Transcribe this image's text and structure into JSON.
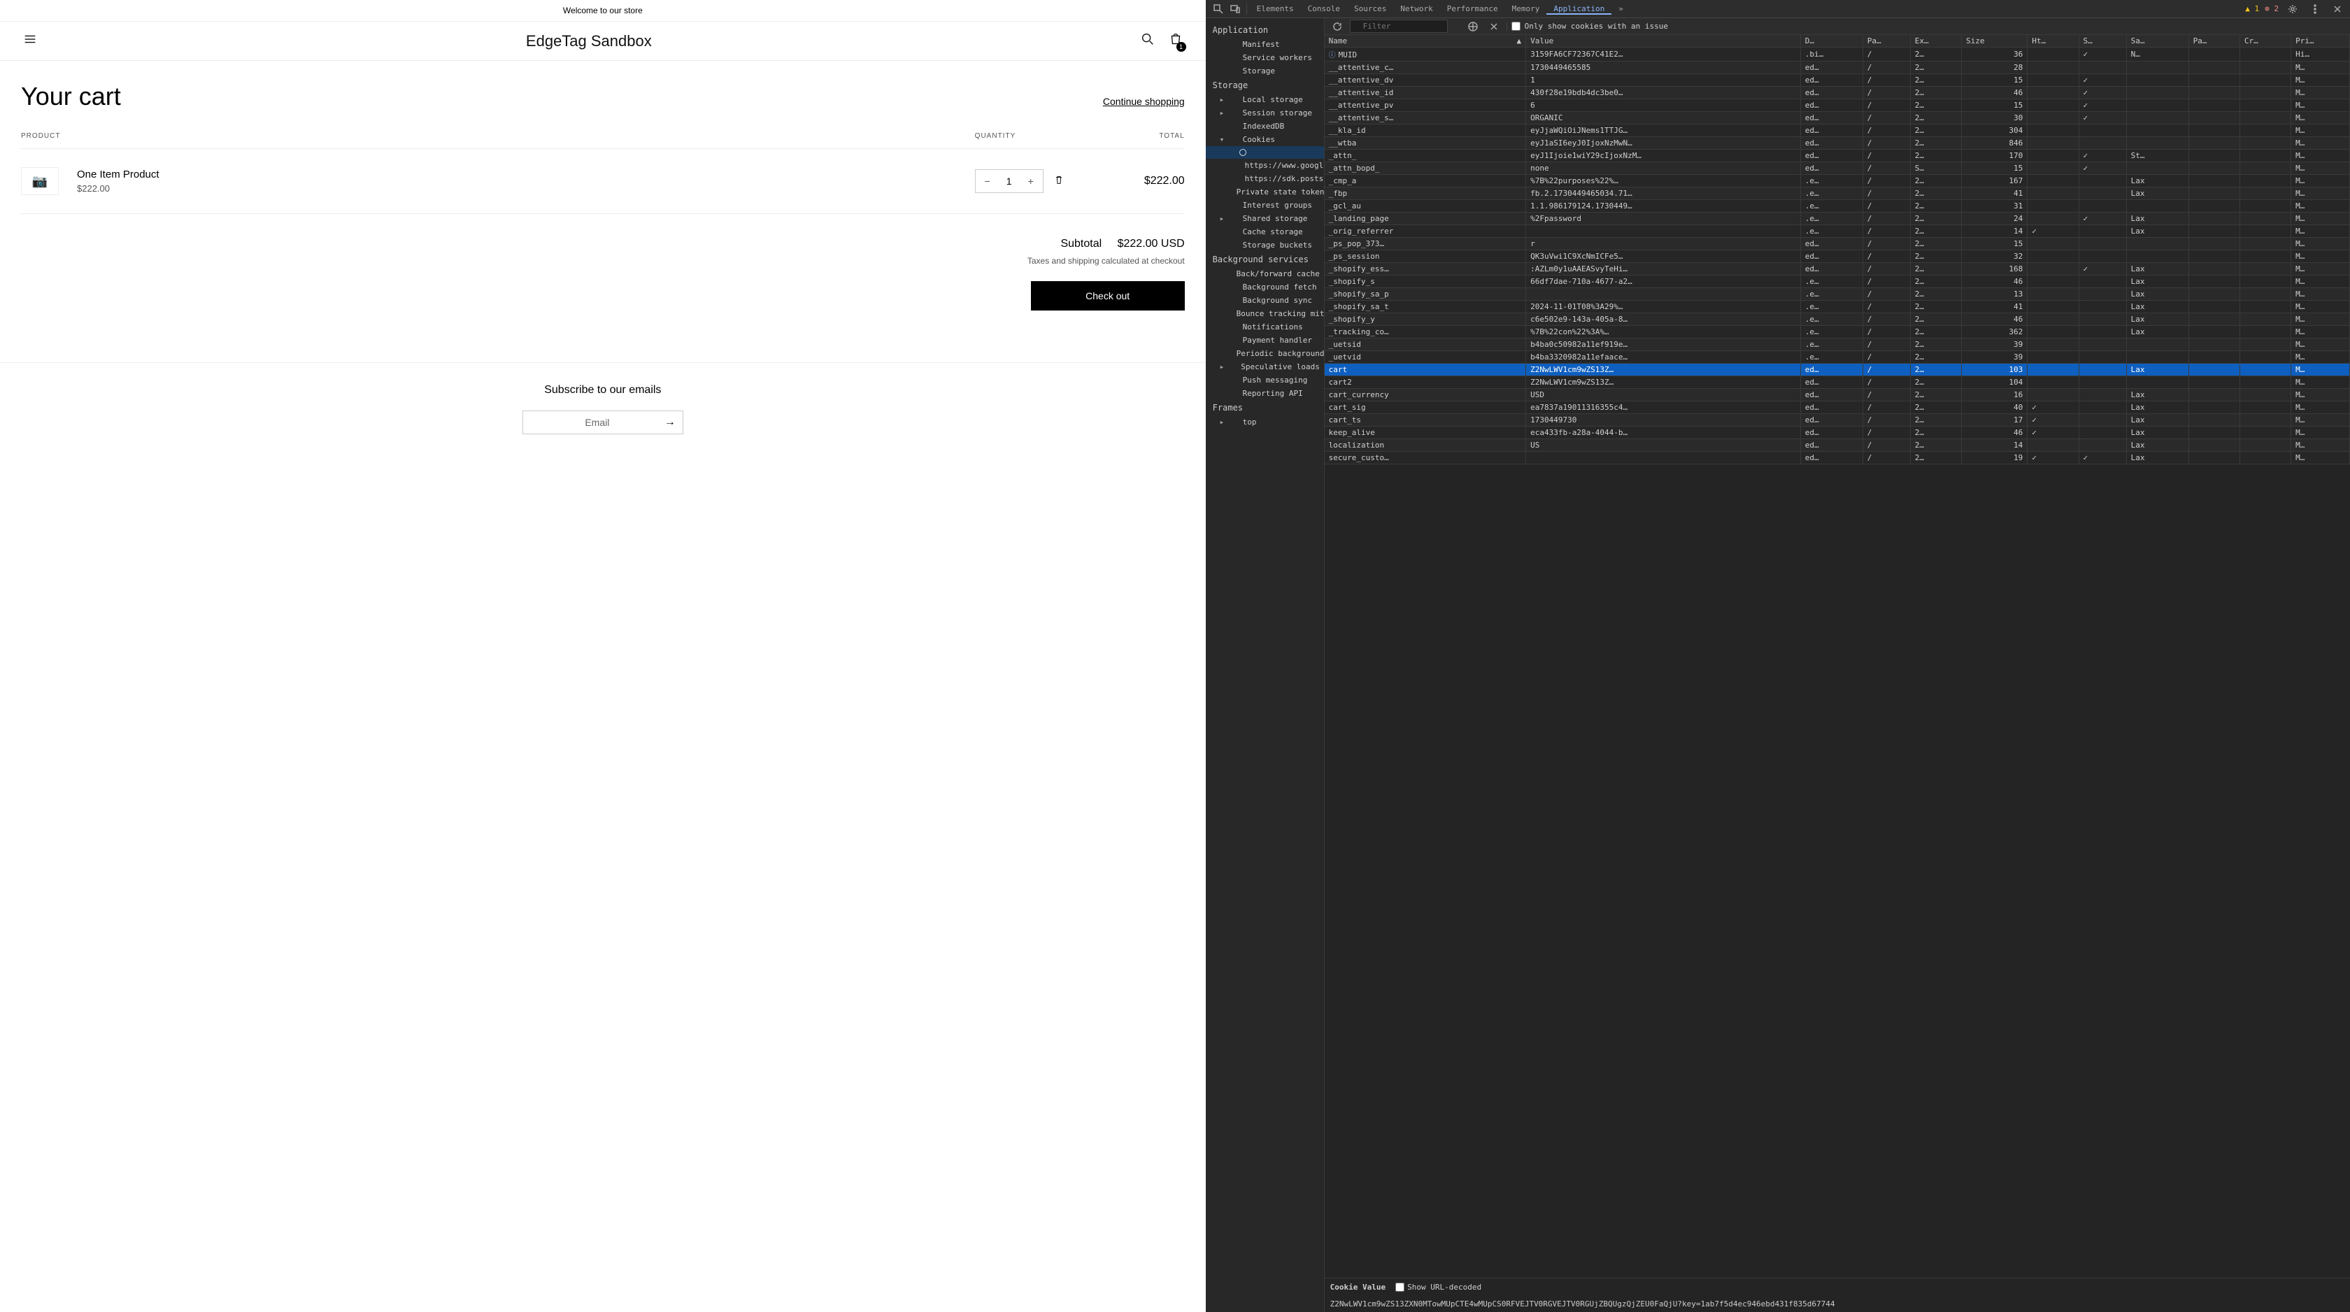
{
  "store": {
    "welcome": "Welcome to our store",
    "brand": "EdgeTag Sandbox",
    "cart_badge": "1",
    "cart_title": "Your cart",
    "continue": "Continue shopping",
    "headers": {
      "product": "PRODUCT",
      "quantity": "QUANTITY",
      "total": "TOTAL"
    },
    "item": {
      "name": "One Item Product",
      "price": "$222.00",
      "qty": "1",
      "total": "$222.00"
    },
    "subtotal_label": "Subtotal",
    "subtotal_value": "$222.00 USD",
    "tax_note": "Taxes and shipping calculated at checkout",
    "checkout": "Check out",
    "subscribe_title": "Subscribe to our emails",
    "email_label": "Email"
  },
  "devtools": {
    "tabs": [
      "Elements",
      "Console",
      "Sources",
      "Network",
      "Performance",
      "Memory",
      "Application"
    ],
    "active_tab": "Application",
    "warn_count": "1",
    "err_count": "2",
    "filter_placeholder": "Filter",
    "only_issue_label": "Only show cookies with an issue",
    "sidebar": {
      "sections": [
        {
          "title": "Application",
          "items": [
            "Manifest",
            "Service workers",
            "Storage"
          ]
        },
        {
          "title": "Storage",
          "items": []
        },
        {
          "title": "Background services",
          "items": []
        },
        {
          "title": "Frames",
          "items": []
        }
      ],
      "storage_items": [
        "Local storage",
        "Session storage",
        "IndexedDB",
        "Cookies"
      ],
      "cookie_children": [
        "https://www.googlet…",
        "https://sdk.postscri…"
      ],
      "storage_items2": [
        "Private state tokens",
        "Interest groups",
        "Shared storage",
        "Cache storage",
        "Storage buckets"
      ],
      "bg_items": [
        "Back/forward cache",
        "Background fetch",
        "Background sync",
        "Bounce tracking mitiga…",
        "Notifications",
        "Payment handler",
        "Periodic background s…",
        "Speculative loads",
        "Push messaging",
        "Reporting API"
      ],
      "frames_items": [
        "top"
      ]
    },
    "columns": [
      "Name",
      "Value",
      "D…",
      "Pa…",
      "Ex…",
      "Size",
      "Ht…",
      "S…",
      "Sa…",
      "Pa…",
      "Cr…",
      "Pri…"
    ],
    "rows": [
      {
        "n": "MUID",
        "v": "3159FA6CF72367C41E2…",
        "d": ".bi…",
        "p": "/",
        "e": "2…",
        "s": "36",
        "h": "",
        "sec": "✓",
        "sa": "N…",
        "pa": "",
        "cr": "",
        "pr": "Hi…",
        "info": true
      },
      {
        "n": "__attentive_c…",
        "v": "1730449465585",
        "d": "ed…",
        "p": "/",
        "e": "2…",
        "s": "28",
        "h": "",
        "sec": "",
        "sa": "",
        "pa": "",
        "cr": "",
        "pr": "M…"
      },
      {
        "n": "__attentive_dv",
        "v": "1",
        "d": "ed…",
        "p": "/",
        "e": "2…",
        "s": "15",
        "h": "",
        "sec": "✓",
        "sa": "",
        "pa": "",
        "cr": "",
        "pr": "M…"
      },
      {
        "n": "__attentive_id",
        "v": "430f28e19bdb4dc3be0…",
        "d": "ed…",
        "p": "/",
        "e": "2…",
        "s": "46",
        "h": "",
        "sec": "✓",
        "sa": "",
        "pa": "",
        "cr": "",
        "pr": "M…"
      },
      {
        "n": "__attentive_pv",
        "v": "6",
        "d": "ed…",
        "p": "/",
        "e": "2…",
        "s": "15",
        "h": "",
        "sec": "✓",
        "sa": "",
        "pa": "",
        "cr": "",
        "pr": "M…"
      },
      {
        "n": "__attentive_s…",
        "v": "ORGANIC",
        "d": "ed…",
        "p": "/",
        "e": "2…",
        "s": "30",
        "h": "",
        "sec": "✓",
        "sa": "",
        "pa": "",
        "cr": "",
        "pr": "M…"
      },
      {
        "n": "__kla_id",
        "v": "eyJjaWQiOiJNems1TTJG…",
        "d": "ed…",
        "p": "/",
        "e": "2…",
        "s": "304",
        "h": "",
        "sec": "",
        "sa": "",
        "pa": "",
        "cr": "",
        "pr": "M…"
      },
      {
        "n": "__wtba",
        "v": "eyJ1aSI6eyJ0IjoxNzMwN…",
        "d": "ed…",
        "p": "/",
        "e": "2…",
        "s": "846",
        "h": "",
        "sec": "",
        "sa": "",
        "pa": "",
        "cr": "",
        "pr": "M…"
      },
      {
        "n": "_attn_",
        "v": "eyJ1Ijoie1wiY29cIjoxNzM…",
        "d": "ed…",
        "p": "/",
        "e": "2…",
        "s": "170",
        "h": "",
        "sec": "✓",
        "sa": "St…",
        "pa": "",
        "cr": "",
        "pr": "M…"
      },
      {
        "n": "_attn_bopd_",
        "v": "none",
        "d": "ed…",
        "p": "/",
        "e": "S…",
        "s": "15",
        "h": "",
        "sec": "✓",
        "sa": "",
        "pa": "",
        "cr": "",
        "pr": "M…"
      },
      {
        "n": "_cmp_a",
        "v": "%7B%22purposes%22%…",
        "d": ".e…",
        "p": "/",
        "e": "2…",
        "s": "167",
        "h": "",
        "sec": "",
        "sa": "Lax",
        "pa": "",
        "cr": "",
        "pr": "M…"
      },
      {
        "n": "_fbp",
        "v": "fb.2.1730449465034.71…",
        "d": ".e…",
        "p": "/",
        "e": "2…",
        "s": "41",
        "h": "",
        "sec": "",
        "sa": "Lax",
        "pa": "",
        "cr": "",
        "pr": "M…"
      },
      {
        "n": "_gcl_au",
        "v": "1.1.986179124.1730449…",
        "d": ".e…",
        "p": "/",
        "e": "2…",
        "s": "31",
        "h": "",
        "sec": "",
        "sa": "",
        "pa": "",
        "cr": "",
        "pr": "M…"
      },
      {
        "n": "_landing_page",
        "v": "%2Fpassword",
        "d": ".e…",
        "p": "/",
        "e": "2…",
        "s": "24",
        "h": "",
        "sec": "✓",
        "sa": "Lax",
        "pa": "",
        "cr": "",
        "pr": "M…"
      },
      {
        "n": "_orig_referrer",
        "v": "",
        "d": ".e…",
        "p": "/",
        "e": "2…",
        "s": "14",
        "h": "✓",
        "sec": "",
        "sa": "Lax",
        "pa": "",
        "cr": "",
        "pr": "M…"
      },
      {
        "n": "_ps_pop_373…",
        "v": "r",
        "d": "ed…",
        "p": "/",
        "e": "2…",
        "s": "15",
        "h": "",
        "sec": "",
        "sa": "",
        "pa": "",
        "cr": "",
        "pr": "M…"
      },
      {
        "n": "_ps_session",
        "v": "QK3uVwi1C9XcNmICFe5…",
        "d": "ed…",
        "p": "/",
        "e": "2…",
        "s": "32",
        "h": "",
        "sec": "",
        "sa": "",
        "pa": "",
        "cr": "",
        "pr": "M…"
      },
      {
        "n": "_shopify_ess…",
        "v": ":AZLm0y1uAAEASvyTeHi…",
        "d": "ed…",
        "p": "/",
        "e": "2…",
        "s": "168",
        "h": "",
        "sec": "✓",
        "sa": "Lax",
        "pa": "",
        "cr": "",
        "pr": "M…"
      },
      {
        "n": "_shopify_s",
        "v": "66df7dae-710a-4677-a2…",
        "d": ".e…",
        "p": "/",
        "e": "2…",
        "s": "46",
        "h": "",
        "sec": "",
        "sa": "Lax",
        "pa": "",
        "cr": "",
        "pr": "M…"
      },
      {
        "n": "_shopify_sa_p",
        "v": "",
        "d": ".e…",
        "p": "/",
        "e": "2…",
        "s": "13",
        "h": "",
        "sec": "",
        "sa": "Lax",
        "pa": "",
        "cr": "",
        "pr": "M…"
      },
      {
        "n": "_shopify_sa_t",
        "v": "2024-11-01T08%3A29%…",
        "d": ".e…",
        "p": "/",
        "e": "2…",
        "s": "41",
        "h": "",
        "sec": "",
        "sa": "Lax",
        "pa": "",
        "cr": "",
        "pr": "M…"
      },
      {
        "n": "_shopify_y",
        "v": "c6e502e9-143a-405a-8…",
        "d": ".e…",
        "p": "/",
        "e": "2…",
        "s": "46",
        "h": "",
        "sec": "",
        "sa": "Lax",
        "pa": "",
        "cr": "",
        "pr": "M…"
      },
      {
        "n": "_tracking_co…",
        "v": "%7B%22con%22%3A%…",
        "d": ".e…",
        "p": "/",
        "e": "2…",
        "s": "362",
        "h": "",
        "sec": "",
        "sa": "Lax",
        "pa": "",
        "cr": "",
        "pr": "M…"
      },
      {
        "n": "_uetsid",
        "v": "b4ba0c50982a11ef919e…",
        "d": ".e…",
        "p": "/",
        "e": "2…",
        "s": "39",
        "h": "",
        "sec": "",
        "sa": "",
        "pa": "",
        "cr": "",
        "pr": "M…"
      },
      {
        "n": "_uetvid",
        "v": "b4ba3320982a11efaace…",
        "d": ".e…",
        "p": "/",
        "e": "2…",
        "s": "39",
        "h": "",
        "sec": "",
        "sa": "",
        "pa": "",
        "cr": "",
        "pr": "M…"
      },
      {
        "n": "cart",
        "v": "Z2NwLWV1cm9wZS13Z…",
        "d": "ed…",
        "p": "/",
        "e": "2…",
        "s": "103",
        "h": "",
        "sec": "",
        "sa": "Lax",
        "pa": "",
        "cr": "",
        "pr": "M…",
        "sel": true
      },
      {
        "n": "cart2",
        "v": "Z2NwLWV1cm9wZS13Z…",
        "d": "ed…",
        "p": "/",
        "e": "2…",
        "s": "104",
        "h": "",
        "sec": "",
        "sa": "",
        "pa": "",
        "cr": "",
        "pr": "M…"
      },
      {
        "n": "cart_currency",
        "v": "USD",
        "d": "ed…",
        "p": "/",
        "e": "2…",
        "s": "16",
        "h": "",
        "sec": "",
        "sa": "Lax",
        "pa": "",
        "cr": "",
        "pr": "M…"
      },
      {
        "n": "cart_sig",
        "v": "ea7837a19011316355c4…",
        "d": "ed…",
        "p": "/",
        "e": "2…",
        "s": "40",
        "h": "✓",
        "sec": "",
        "sa": "Lax",
        "pa": "",
        "cr": "",
        "pr": "M…"
      },
      {
        "n": "cart_ts",
        "v": "1730449730",
        "d": "ed…",
        "p": "/",
        "e": "2…",
        "s": "17",
        "h": "✓",
        "sec": "",
        "sa": "Lax",
        "pa": "",
        "cr": "",
        "pr": "M…"
      },
      {
        "n": "keep_alive",
        "v": "eca433fb-a28a-4044-b…",
        "d": "ed…",
        "p": "/",
        "e": "2…",
        "s": "46",
        "h": "✓",
        "sec": "",
        "sa": "Lax",
        "pa": "",
        "cr": "",
        "pr": "M…"
      },
      {
        "n": "localization",
        "v": "US",
        "d": "ed…",
        "p": "/",
        "e": "2…",
        "s": "14",
        "h": "",
        "sec": "",
        "sa": "Lax",
        "pa": "",
        "cr": "",
        "pr": "M…"
      },
      {
        "n": "secure_custo…",
        "v": "",
        "d": "ed…",
        "p": "/",
        "e": "2…",
        "s": "19",
        "h": "✓",
        "sec": "✓",
        "sa": "Lax",
        "pa": "",
        "cr": "",
        "pr": "M…"
      }
    ],
    "cookie_value_label": "Cookie Value",
    "show_decoded_label": "Show URL-decoded",
    "cookie_value": "Z2NwLWV1cm9wZS13ZXN0MTowMUpCTE4wMUpCS0RFVEJTV0RGVEJTV0RGUjZBQUgzQjZEU0FaQjU?key=1ab7f5d4ec946ebd431f835d67744"
  }
}
